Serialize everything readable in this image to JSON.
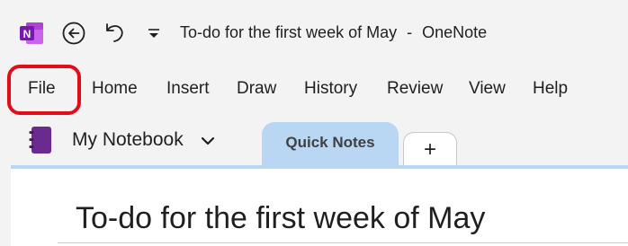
{
  "titlebar": {
    "title": "To-do for the first week of May",
    "separator": "-",
    "app_name": "OneNote",
    "brand_color": "#7719aa",
    "icons": [
      "onenote-logo-icon",
      "back-arrow-icon",
      "undo-icon",
      "quick-access-dropdown-icon"
    ]
  },
  "ribbon": {
    "tabs": [
      "File",
      "Home",
      "Insert",
      "Draw",
      "History",
      "Review",
      "View",
      "Help"
    ],
    "highlight_color": "#e30d1a"
  },
  "notebook": {
    "name": "My Notebook",
    "icon": "notebook-icon",
    "color": "#6a2a8f"
  },
  "sections": {
    "active": "Quick Notes",
    "active_color": "#b9d6f2",
    "add_label": "+"
  },
  "page": {
    "title": "To-do for the first week of May"
  }
}
